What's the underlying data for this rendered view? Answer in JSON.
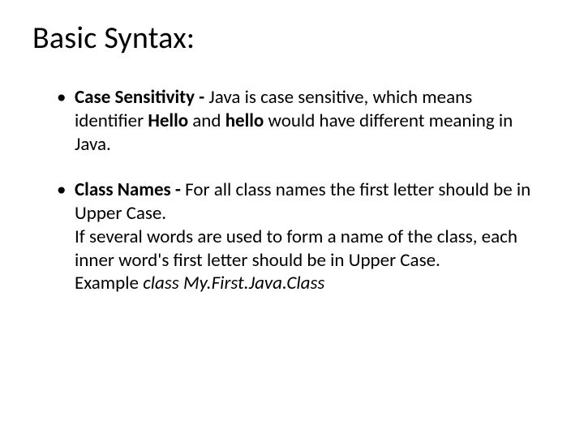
{
  "title": "Basic Syntax:",
  "bullets": [
    {
      "bold_lead": "Case Sensitivity - ",
      "text1": "Java is case sensitive, which means identifier ",
      "bold_mid1": "Hello",
      "text2": " and ",
      "bold_mid2": "hello",
      "text3": " would have different meaning in Java."
    },
    {
      "bold_lead": "Class Names - ",
      "text1": "For all class names the first letter should be in Upper Case.",
      "br": true,
      "text2": "If several words are used to form a name of the class, each inner word's first letter should be in Upper Case.",
      "br2": true,
      "text3": "Example ",
      "italic1": "class My.First.Java.Class"
    }
  ]
}
